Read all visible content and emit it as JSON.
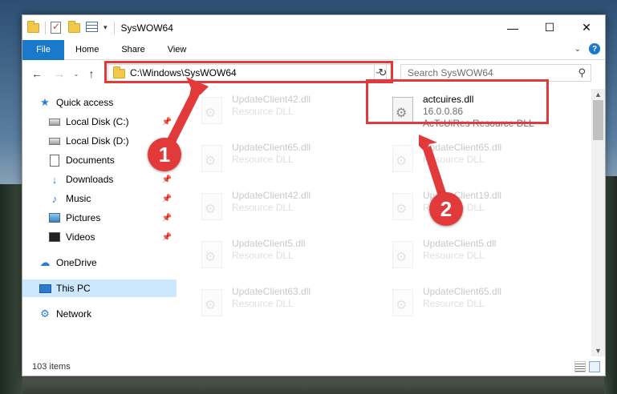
{
  "window": {
    "title": "SysWOW64",
    "controls": {
      "minimize": "—",
      "maximize": "☐",
      "close": "✕"
    },
    "qat_arrow": "▾"
  },
  "ribbon": {
    "tabs": [
      "File",
      "Home",
      "Share",
      "View"
    ],
    "help_icon": "?",
    "expand_icon": "⌄"
  },
  "address": {
    "back": "←",
    "forward": "→",
    "recent": "⌄",
    "up": "↑",
    "path": "C:\\Windows\\SysWOW64",
    "dropdown": "⌄",
    "refresh": "↻"
  },
  "search": {
    "placeholder": "Search SysWOW64",
    "icon": "⚲"
  },
  "nav": {
    "items": [
      {
        "label": "Quick access",
        "icon": "star-icon",
        "glyph": "★",
        "pinned": false
      },
      {
        "label": "Local Disk (C:)",
        "icon": "disk-icon",
        "glyph": "",
        "pinned": true
      },
      {
        "label": "Local Disk (D:)",
        "icon": "disk-icon",
        "glyph": "",
        "pinned": false
      },
      {
        "label": "Documents",
        "icon": "document-icon",
        "glyph": "",
        "pinned": true
      },
      {
        "label": "Downloads",
        "icon": "download-icon",
        "glyph": "↓",
        "pinned": true
      },
      {
        "label": "Music",
        "icon": "music-icon",
        "glyph": "♪",
        "pinned": true
      },
      {
        "label": "Pictures",
        "icon": "pictures-icon",
        "glyph": "",
        "pinned": true
      },
      {
        "label": "Videos",
        "icon": "videos-icon",
        "glyph": "",
        "pinned": true
      },
      {
        "label": "OneDrive",
        "icon": "cloud-icon",
        "glyph": "☁",
        "pinned": false
      },
      {
        "label": "This PC",
        "icon": "computer-icon",
        "glyph": "",
        "pinned": false,
        "selected": true
      },
      {
        "label": "Network",
        "icon": "network-icon",
        "glyph": "⚙",
        "pinned": false
      }
    ],
    "pin_glyph": "📌"
  },
  "files": [
    {
      "name": "UpdateClient42.dll",
      "type": "Resource DLL",
      "faded": true
    },
    {
      "name": "actcuires.dll",
      "version": "16.0.0.86",
      "type": "AcTcUiRes Resource DLL",
      "faded": false
    },
    {
      "name": "UpdateClient65.dll",
      "type": "Resource DLL",
      "faded": true
    },
    {
      "name": "UpdateClient65.dll",
      "type": "Resource DLL",
      "faded": true
    },
    {
      "name": "UpdateClient42.dll",
      "type": "Resource DLL",
      "faded": true
    },
    {
      "name": "UpdateClient19.dll",
      "type": "Resource DLL",
      "faded": true
    },
    {
      "name": "UpdateClient5.dll",
      "type": "Resource DLL",
      "faded": true
    },
    {
      "name": "UpdateClient5.dll",
      "type": "Resource DLL",
      "faded": true
    },
    {
      "name": "UpdateClient63.dll",
      "type": "Resource DLL",
      "faded": true
    },
    {
      "name": "UpdateClient65.dll",
      "type": "Resource DLL",
      "faded": true
    }
  ],
  "status": {
    "item_count": "103 items"
  },
  "annotations": {
    "badge_1": "1",
    "badge_2": "2",
    "color": "#e23a3a"
  },
  "scroll": {
    "up": "▲",
    "down": "▼"
  }
}
